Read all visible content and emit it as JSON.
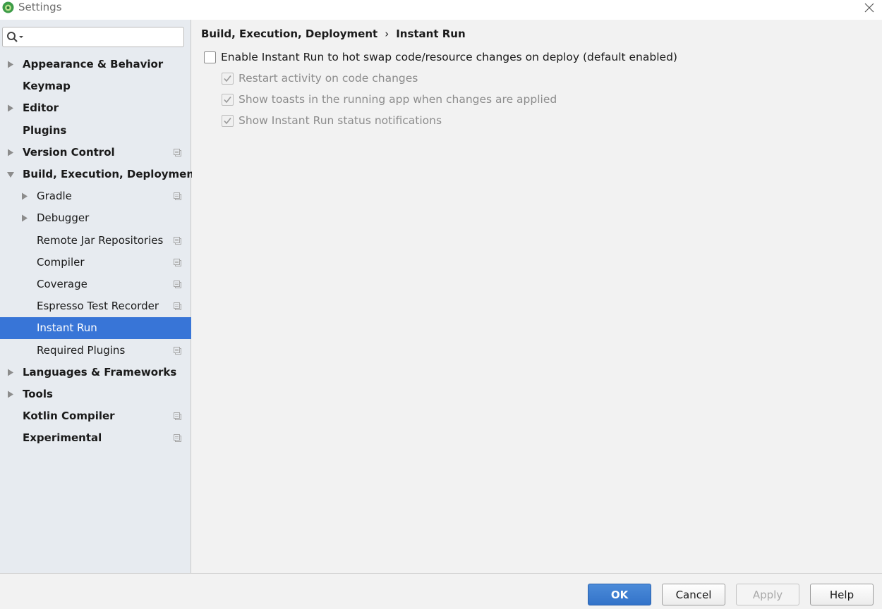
{
  "window": {
    "title": "Settings"
  },
  "search": {
    "value": "",
    "placeholder": ""
  },
  "sidebar": {
    "items": [
      {
        "label": "Appearance & Behavior",
        "bold": true,
        "arrow": "right",
        "level": 0,
        "project_icon": false
      },
      {
        "label": "Keymap",
        "bold": true,
        "arrow": "none",
        "level": 0,
        "project_icon": false
      },
      {
        "label": "Editor",
        "bold": true,
        "arrow": "right",
        "level": 0,
        "project_icon": false
      },
      {
        "label": "Plugins",
        "bold": true,
        "arrow": "none",
        "level": 0,
        "project_icon": false
      },
      {
        "label": "Version Control",
        "bold": true,
        "arrow": "right",
        "level": 0,
        "project_icon": true
      },
      {
        "label": "Build, Execution, Deployment",
        "bold": true,
        "arrow": "down",
        "level": 0,
        "project_icon": false
      },
      {
        "label": "Gradle",
        "bold": false,
        "arrow": "right",
        "level": 1,
        "project_icon": true
      },
      {
        "label": "Debugger",
        "bold": false,
        "arrow": "right",
        "level": 1,
        "project_icon": false
      },
      {
        "label": "Remote Jar Repositories",
        "bold": false,
        "arrow": "none",
        "level": 1,
        "project_icon": true
      },
      {
        "label": "Compiler",
        "bold": false,
        "arrow": "none",
        "level": 1,
        "project_icon": true
      },
      {
        "label": "Coverage",
        "bold": false,
        "arrow": "none",
        "level": 1,
        "project_icon": true
      },
      {
        "label": "Espresso Test Recorder",
        "bold": false,
        "arrow": "none",
        "level": 1,
        "project_icon": true
      },
      {
        "label": "Instant Run",
        "bold": false,
        "arrow": "none",
        "level": 1,
        "project_icon": false,
        "selected": true
      },
      {
        "label": "Required Plugins",
        "bold": false,
        "arrow": "none",
        "level": 1,
        "project_icon": true
      },
      {
        "label": "Languages & Frameworks",
        "bold": true,
        "arrow": "right",
        "level": 0,
        "project_icon": false
      },
      {
        "label": "Tools",
        "bold": true,
        "arrow": "right",
        "level": 0,
        "project_icon": false
      },
      {
        "label": "Kotlin Compiler",
        "bold": true,
        "arrow": "none",
        "level": 0,
        "project_icon": true
      },
      {
        "label": "Experimental",
        "bold": true,
        "arrow": "none",
        "level": 0,
        "project_icon": true
      }
    ]
  },
  "breadcrumb": {
    "parent": "Build, Execution, Deployment",
    "separator": "›",
    "current": "Instant Run"
  },
  "options": [
    {
      "label": "Enable Instant Run to hot swap code/resource changes on deploy (default enabled)",
      "checked": false,
      "enabled": true
    },
    {
      "label": "Restart activity on code changes",
      "checked": true,
      "enabled": false
    },
    {
      "label": "Show toasts in the running app when changes are applied",
      "checked": true,
      "enabled": false
    },
    {
      "label": "Show Instant Run status notifications",
      "checked": true,
      "enabled": false
    }
  ],
  "buttons": {
    "ok": "OK",
    "cancel": "Cancel",
    "apply": "Apply",
    "help": "Help"
  },
  "colors": {
    "selection": "#3875d7",
    "sidebar_bg": "#e7ebf0",
    "panel_bg": "#f2f2f2",
    "primary_button": "#3a7bd1"
  }
}
